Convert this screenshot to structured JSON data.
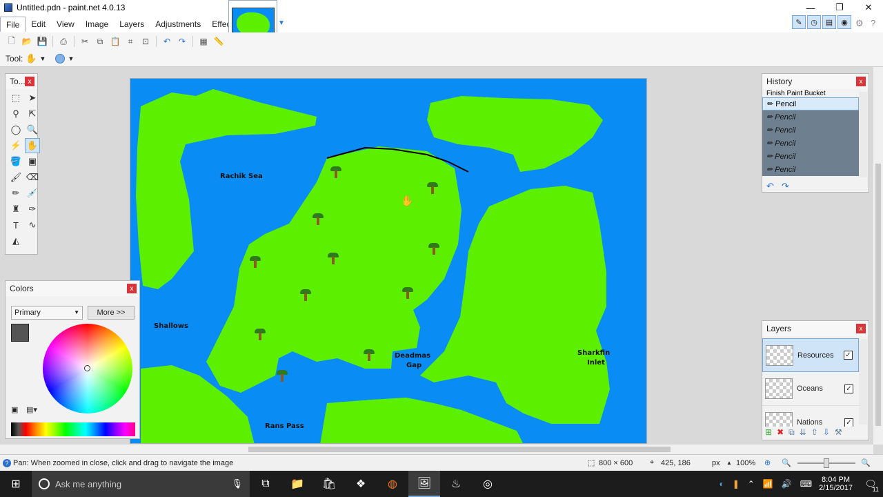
{
  "window": {
    "title": "Untitled.pdn - paint.net 4.0.13",
    "min": "—",
    "restore": "❐",
    "close": "✕"
  },
  "menu": [
    "File",
    "Edit",
    "View",
    "Image",
    "Layers",
    "Adjustments",
    "Effects"
  ],
  "toolbar2": {
    "tool_label": "Tool:"
  },
  "tools_panel": {
    "title": "To...",
    "close": "x"
  },
  "colors_panel": {
    "title": "Colors",
    "close": "x",
    "primary_select": "Primary",
    "more_button": "More >>"
  },
  "history_panel": {
    "title": "History",
    "close": "x",
    "items": [
      {
        "label": "Finish Paint Bucket",
        "state": "done"
      },
      {
        "label": "Pencil",
        "state": "current"
      },
      {
        "label": "Pencil",
        "state": "undone"
      },
      {
        "label": "Pencil",
        "state": "undone"
      },
      {
        "label": "Pencil",
        "state": "undone"
      },
      {
        "label": "Pencil",
        "state": "undone"
      },
      {
        "label": "Pencil",
        "state": "undone"
      }
    ]
  },
  "layers_panel": {
    "title": "Layers",
    "close": "x",
    "layers": [
      {
        "name": "Resources",
        "visible": true,
        "selected": true
      },
      {
        "name": "Oceans",
        "visible": true,
        "selected": false
      },
      {
        "name": "Nations",
        "visible": true,
        "selected": false
      }
    ]
  },
  "map_labels": {
    "rachik": "Rachik Sea",
    "shallows": "Shallows",
    "deadman_1": "Deadmas",
    "deadman_2": "Gap",
    "sharkfin_1": "Sharkfin",
    "sharkfin_2": "Inlet",
    "rans": "Rans Pass"
  },
  "status": {
    "hint": "Pan: When zoomed in close, click and drag to navigate the image",
    "image_size": "800 × 600",
    "cursor_pos": "425, 186",
    "unit": "px",
    "zoom": "100%"
  },
  "taskbar": {
    "search_placeholder": "Ask me anything",
    "time": "8:04 PM",
    "date": "2/15/2017",
    "notif_count": "11"
  },
  "colors": {
    "ocean": "#0a8cf5",
    "land": "#5cf000",
    "accent": "#0078d7"
  }
}
